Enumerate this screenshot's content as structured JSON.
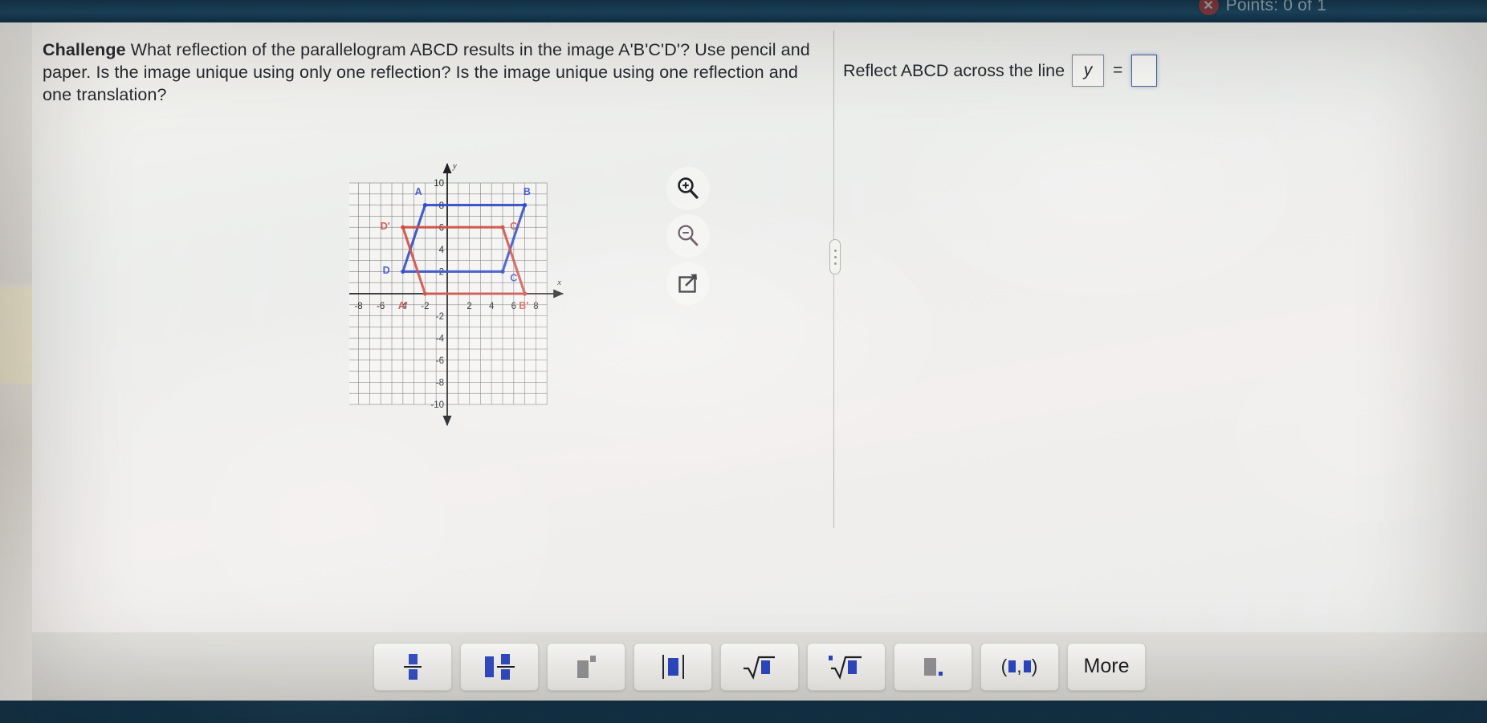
{
  "topbar": {
    "points_label": "Points: 0 of 1",
    "status_icon": "x-circle-icon"
  },
  "question": {
    "label": "Challenge",
    "body_line1": "What reflection of the parallelogram ABCD results in the image A'B'C'D'? Use",
    "body_line2": "pencil and paper. Is the image unique using only one reflection? Is the image unique using",
    "body_line3": "one reflection and one translation?"
  },
  "answer": {
    "prompt": "Reflect ABCD across the line",
    "variable_value": "y",
    "equals": "=",
    "input_value": ""
  },
  "tools": [
    {
      "name": "zoom-in-icon",
      "label": "Zoom in"
    },
    {
      "name": "zoom-out-icon",
      "label": "Zoom out"
    },
    {
      "name": "expand-icon",
      "label": "Open enlarged view"
    }
  ],
  "keypad": {
    "keys": [
      {
        "name": "fraction-key",
        "label": "fraction"
      },
      {
        "name": "mixed-number-key",
        "label": "mixed number"
      },
      {
        "name": "exponent-key",
        "label": "exponent"
      },
      {
        "name": "absolute-value-key",
        "label": "absolute value"
      },
      {
        "name": "square-root-key",
        "label": "square root"
      },
      {
        "name": "nth-root-key",
        "label": "nth root"
      },
      {
        "name": "decimal-key",
        "label": "decimal point"
      },
      {
        "name": "ordered-pair-key",
        "label": "ordered pair"
      }
    ],
    "more_label": "More"
  },
  "chart_data": {
    "type": "scatter",
    "title": "",
    "xlabel": "x",
    "ylabel": "y",
    "xlim": [
      -10,
      10
    ],
    "ylim": [
      -10,
      10
    ],
    "grid": true,
    "xticks": [
      -8,
      -6,
      -4,
      -2,
      2,
      4,
      6,
      8
    ],
    "yticks": [
      10,
      8,
      6,
      4,
      2,
      -2,
      -4,
      -6,
      -8,
      -10
    ],
    "xtick_labels": [
      "-8",
      "-6",
      "-4",
      "-2",
      "2",
      "4",
      "6",
      "8"
    ],
    "ytick_labels": [
      "10",
      "8",
      "6",
      "4",
      "2",
      "-2",
      "-4",
      "-6",
      "-8",
      "-10"
    ],
    "axis_arrow_labels": {
      "x": "x",
      "y": "y"
    },
    "series": [
      {
        "name": "ABCD",
        "color": "#2f49c6",
        "closed": true,
        "points": [
          {
            "label": "A",
            "x": -2,
            "y": 8,
            "label_dx": -0.6,
            "label_dy": 1.2
          },
          {
            "label": "B",
            "x": 7,
            "y": 8,
            "label_dx": 0.2,
            "label_dy": 1.2
          },
          {
            "label": "C",
            "x": 5,
            "y": 2,
            "label_dx": 1.0,
            "label_dy": -0.6
          },
          {
            "label": "D",
            "x": -4,
            "y": 2,
            "label_dx": -1.5,
            "label_dy": 0.1
          }
        ]
      },
      {
        "name": "A'B'C'D'",
        "color": "#cf4a41",
        "closed": true,
        "points": [
          {
            "label": "A'",
            "x": -2,
            "y": 0,
            "label_dx": -2.0,
            "label_dy": -1.1
          },
          {
            "label": "B'",
            "x": 7,
            "y": 0,
            "label_dx": -0.1,
            "label_dy": -1.1
          },
          {
            "label": "C'",
            "x": 5,
            "y": 6,
            "label_dx": 1.1,
            "label_dy": 0.1
          },
          {
            "label": "D'",
            "x": -4,
            "y": 6,
            "label_dx": -1.6,
            "label_dy": 0.1
          }
        ]
      }
    ]
  }
}
